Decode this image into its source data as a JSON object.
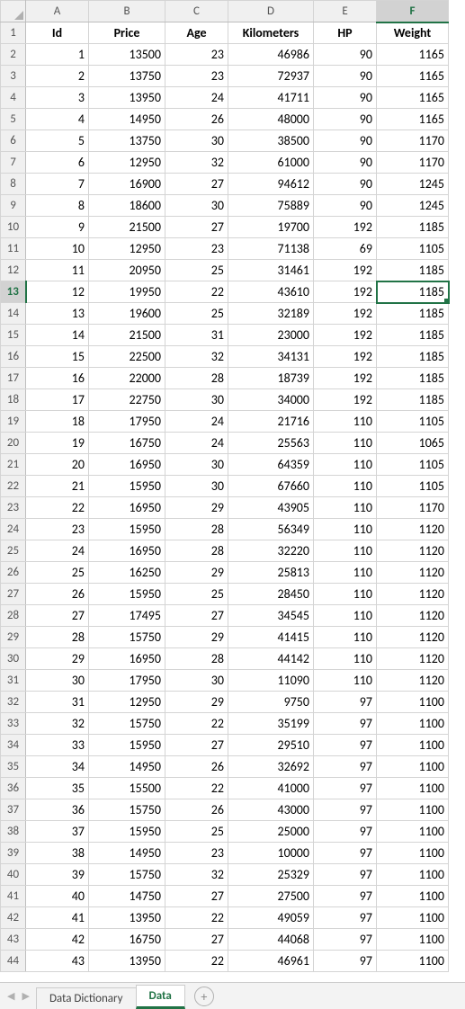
{
  "columns": [
    "A",
    "B",
    "C",
    "D",
    "E",
    "F"
  ],
  "headers": [
    "Id",
    "Price",
    "Age",
    "Kilometers",
    "HP",
    "Weight"
  ],
  "selected_cell": {
    "row_index": 11,
    "col_index": 5
  },
  "tabs": {
    "items": [
      "Data Dictionary",
      "Data"
    ],
    "active_index": 1
  },
  "chart_data": {
    "type": "table",
    "title": "",
    "columns": [
      "Id",
      "Price",
      "Age",
      "Kilometers",
      "HP",
      "Weight"
    ],
    "rows": [
      [
        1,
        13500,
        23,
        46986,
        90,
        1165
      ],
      [
        2,
        13750,
        23,
        72937,
        90,
        1165
      ],
      [
        3,
        13950,
        24,
        41711,
        90,
        1165
      ],
      [
        4,
        14950,
        26,
        48000,
        90,
        1165
      ],
      [
        5,
        13750,
        30,
        38500,
        90,
        1170
      ],
      [
        6,
        12950,
        32,
        61000,
        90,
        1170
      ],
      [
        7,
        16900,
        27,
        94612,
        90,
        1245
      ],
      [
        8,
        18600,
        30,
        75889,
        90,
        1245
      ],
      [
        9,
        21500,
        27,
        19700,
        192,
        1185
      ],
      [
        10,
        12950,
        23,
        71138,
        69,
        1105
      ],
      [
        11,
        20950,
        25,
        31461,
        192,
        1185
      ],
      [
        12,
        19950,
        22,
        43610,
        192,
        1185
      ],
      [
        13,
        19600,
        25,
        32189,
        192,
        1185
      ],
      [
        14,
        21500,
        31,
        23000,
        192,
        1185
      ],
      [
        15,
        22500,
        32,
        34131,
        192,
        1185
      ],
      [
        16,
        22000,
        28,
        18739,
        192,
        1185
      ],
      [
        17,
        22750,
        30,
        34000,
        192,
        1185
      ],
      [
        18,
        17950,
        24,
        21716,
        110,
        1105
      ],
      [
        19,
        16750,
        24,
        25563,
        110,
        1065
      ],
      [
        20,
        16950,
        30,
        64359,
        110,
        1105
      ],
      [
        21,
        15950,
        30,
        67660,
        110,
        1105
      ],
      [
        22,
        16950,
        29,
        43905,
        110,
        1170
      ],
      [
        23,
        15950,
        28,
        56349,
        110,
        1120
      ],
      [
        24,
        16950,
        28,
        32220,
        110,
        1120
      ],
      [
        25,
        16250,
        29,
        25813,
        110,
        1120
      ],
      [
        26,
        15950,
        25,
        28450,
        110,
        1120
      ],
      [
        27,
        17495,
        27,
        34545,
        110,
        1120
      ],
      [
        28,
        15750,
        29,
        41415,
        110,
        1120
      ],
      [
        29,
        16950,
        28,
        44142,
        110,
        1120
      ],
      [
        30,
        17950,
        30,
        11090,
        110,
        1120
      ],
      [
        31,
        12950,
        29,
        9750,
        97,
        1100
      ],
      [
        32,
        15750,
        22,
        35199,
        97,
        1100
      ],
      [
        33,
        15950,
        27,
        29510,
        97,
        1100
      ],
      [
        34,
        14950,
        26,
        32692,
        97,
        1100
      ],
      [
        35,
        15500,
        22,
        41000,
        97,
        1100
      ],
      [
        36,
        15750,
        26,
        43000,
        97,
        1100
      ],
      [
        37,
        15950,
        25,
        25000,
        97,
        1100
      ],
      [
        38,
        14950,
        23,
        10000,
        97,
        1100
      ],
      [
        39,
        15750,
        32,
        25329,
        97,
        1100
      ],
      [
        40,
        14750,
        27,
        27500,
        97,
        1100
      ],
      [
        41,
        13950,
        22,
        49059,
        97,
        1100
      ],
      [
        42,
        16750,
        27,
        44068,
        97,
        1100
      ],
      [
        43,
        13950,
        22,
        46961,
        97,
        1100
      ]
    ]
  }
}
